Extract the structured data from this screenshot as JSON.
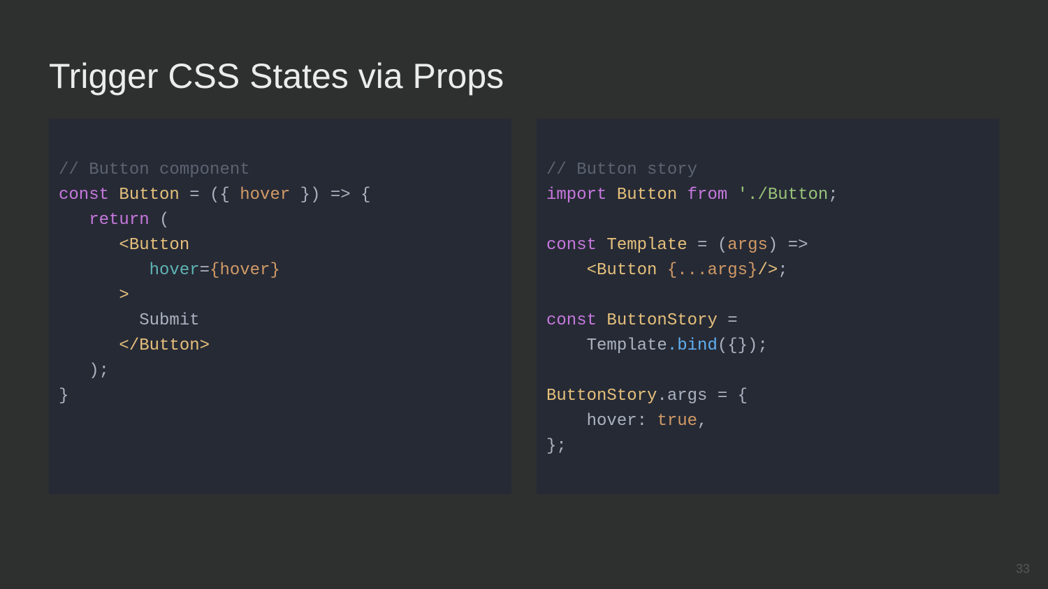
{
  "title": "Trigger CSS States via Props",
  "page_number": "33",
  "left": {
    "c1": "// Button component",
    "l2_const": "const",
    "l2_name": " Button ",
    "l2_eq": "= ({ ",
    "l2_prop": "hover",
    "l2_rest": " }) => {",
    "l3_return": "   return",
    "l3_paren": " (",
    "l4_open": "      <Button",
    "l5_attr": "         hover",
    "l5_eq": "=",
    "l5_val": "{hover}",
    "l6_gt": "      >",
    "l7_text": "        Submit",
    "l8_close": "      </Button>",
    "l9_paren": "   );",
    "l10_brace": "}"
  },
  "right": {
    "c1": "// Button story",
    "l2_import": "import",
    "l2_name": " Button ",
    "l2_from": "from",
    "l2_path": " './Button",
    "l2_semi": ";",
    "l4_const": "const",
    "l4_name": " Template ",
    "l4_eq": "= (",
    "l4_arg": "args",
    "l4_rest": ") =>",
    "l5_open": "    <Button ",
    "l5_spread": "{...args}",
    "l5_close": "/>",
    "l5_semi": ";",
    "l7_const": "const",
    "l7_name": " ButtonStory ",
    "l7_eq": "=",
    "l8_tpl": "    Template",
    "l8_bind": ".bind",
    "l8_arg": "({});",
    "l10_bs": "ButtonStory",
    "l10_args": ".args ",
    "l10_eq": "= {",
    "l11_key": "    hover",
    "l11_colon": ": ",
    "l11_val": "true",
    "l11_comma": ",",
    "l12_close": "};"
  }
}
